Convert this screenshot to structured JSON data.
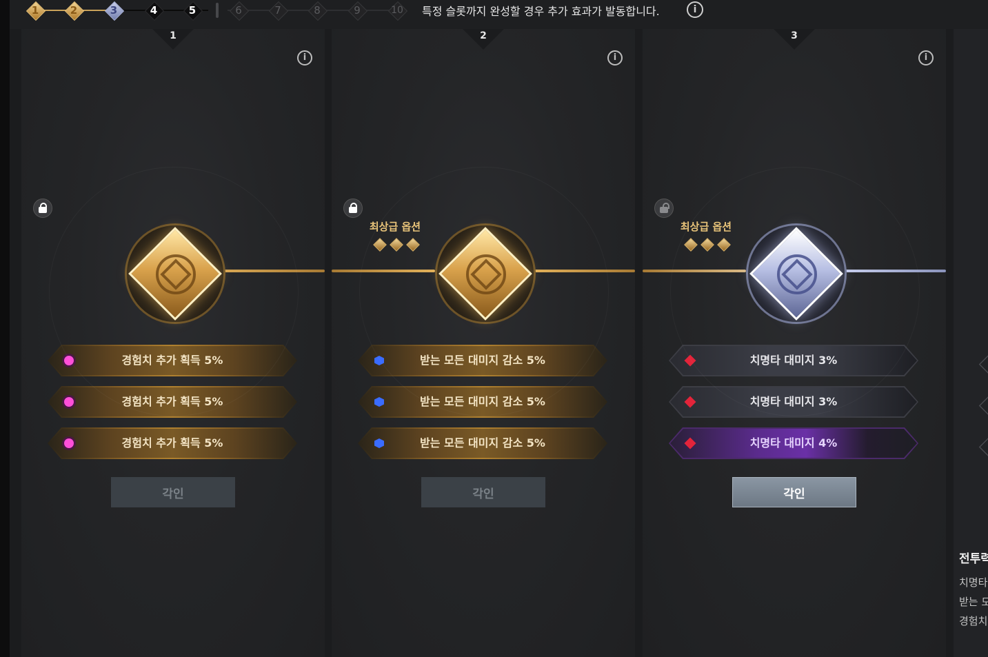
{
  "stepper": {
    "steps": [
      "1",
      "2",
      "3",
      "4",
      "5",
      "6",
      "7",
      "8",
      "9",
      "10"
    ],
    "message": "특정 슬롯까지 완성할 경우 추가 효과가 발동합니다.",
    "info_icon": "info-icon"
  },
  "colors": {
    "gold": "#d9a24c",
    "silver": "#b8c0e4",
    "pink_gem": "#ff4fd8",
    "blue_gem": "#3a6cff",
    "red_gem": "#e3243a",
    "purple_option": "#6a30a6"
  },
  "slots": [
    {
      "number": "1",
      "locked": true,
      "top_option": "",
      "emblem": "gold",
      "options": [
        {
          "text": "경험치 추가 획득 5%",
          "gem": "pink"
        },
        {
          "text": "경험치 추가 획득 5%",
          "gem": "pink"
        },
        {
          "text": "경험치 추가 획득 5%",
          "gem": "pink"
        }
      ],
      "button": "각인",
      "button_active": false
    },
    {
      "number": "2",
      "locked": true,
      "top_option": "최상급 옵션",
      "emblem": "gold",
      "options": [
        {
          "text": "받는 모든 대미지 감소 5%",
          "gem": "blue"
        },
        {
          "text": "받는 모든 대미지 감소 5%",
          "gem": "blue"
        },
        {
          "text": "받는 모든 대미지 감소 5%",
          "gem": "blue"
        }
      ],
      "button": "각인",
      "button_active": false
    },
    {
      "number": "3",
      "locked": false,
      "top_option": "최상급 옵션",
      "emblem": "silver",
      "options": [
        {
          "text": "치명타 대미지 3%",
          "gem": "red"
        },
        {
          "text": "치명타 대미지 3%",
          "gem": "red"
        },
        {
          "text": "치명타 대미지 4%",
          "gem": "red"
        }
      ],
      "button": "각인",
      "button_active": true
    }
  ],
  "side_panel": {
    "title": "전투력",
    "lines": [
      "치명타",
      "받는 모",
      "경험치"
    ]
  }
}
